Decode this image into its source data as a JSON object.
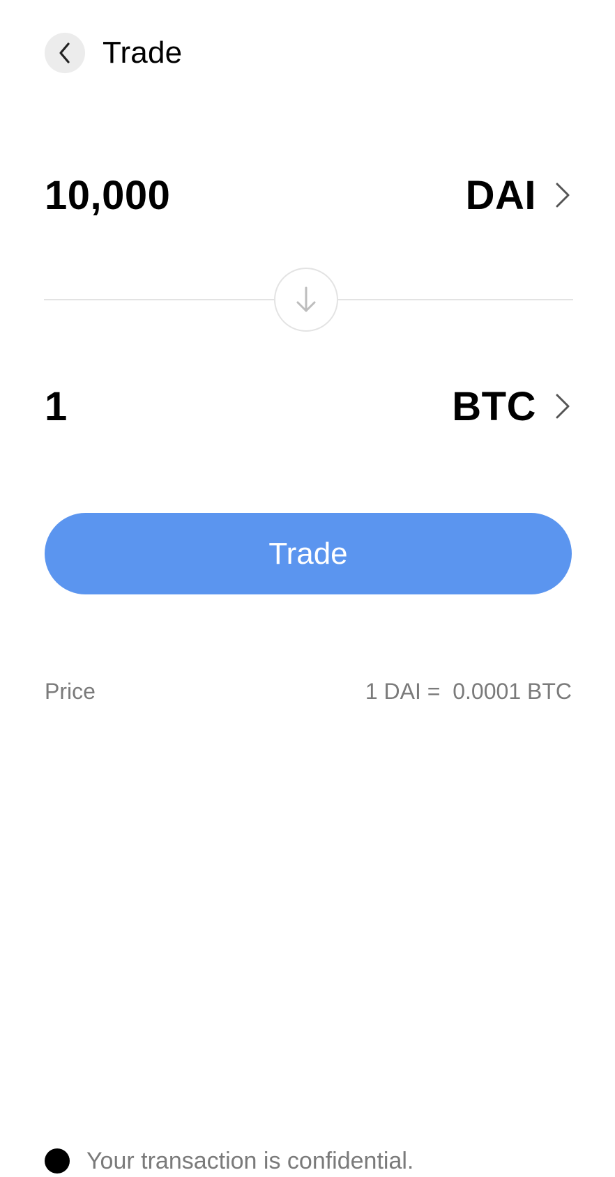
{
  "header": {
    "back_icon": "chevron-left-icon",
    "title": "Trade"
  },
  "from": {
    "amount": "10,000",
    "token": "DAI",
    "chevron_icon": "chevron-right-icon"
  },
  "swap": {
    "icon": "arrow-down-icon"
  },
  "to": {
    "amount": "1",
    "token": "BTC",
    "chevron_icon": "chevron-right-icon"
  },
  "trade_button": {
    "label": "Trade",
    "color": "#5b95ef"
  },
  "price": {
    "label": "Price",
    "value": "1 DAI =  0.0001 BTC"
  },
  "footer": {
    "text": "Your transaction is confidential."
  }
}
